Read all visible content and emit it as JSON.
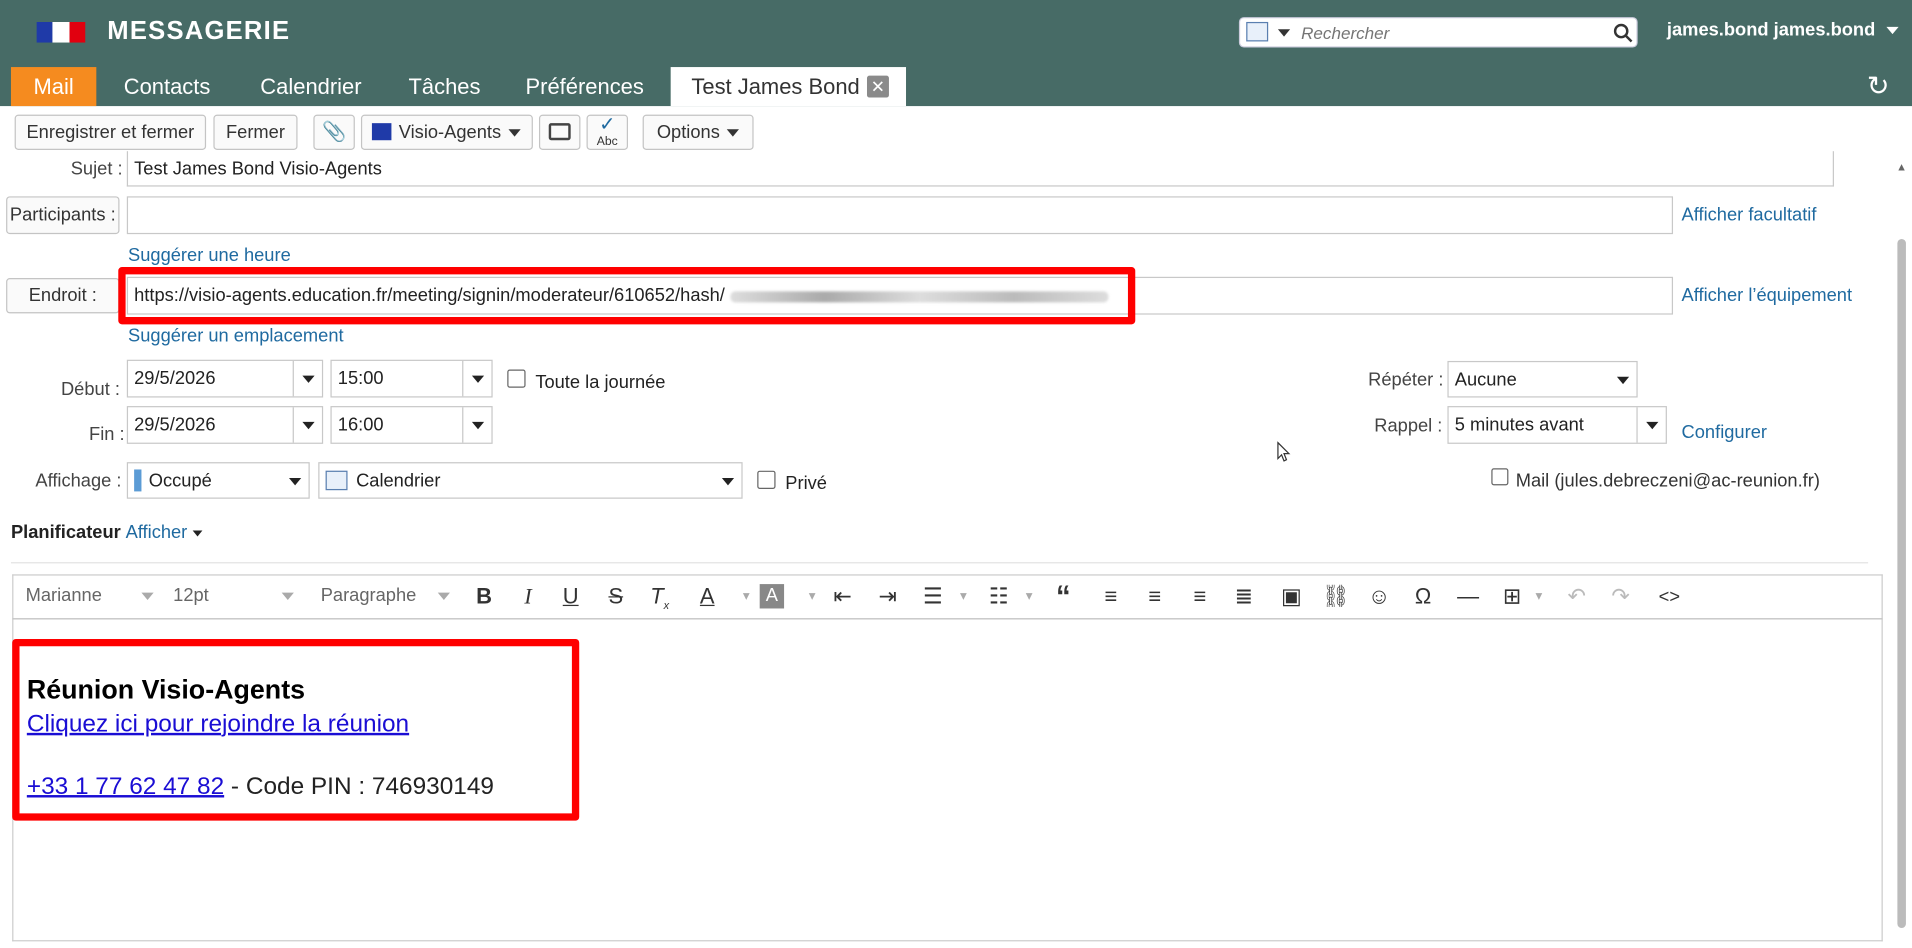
{
  "header": {
    "app_title": "MESSAGERIE",
    "search_placeholder": "Rechercher",
    "user_name": "james.bond james.bond"
  },
  "tabs": [
    "Mail",
    "Contacts",
    "Calendrier",
    "Tâches",
    "Préférences"
  ],
  "active_tab": {
    "label": "Test James Bond",
    "close": "✕"
  },
  "toolbar": {
    "save_close": "Enregistrer et fermer",
    "close": "Fermer",
    "visio": "Visio-Agents",
    "options": "Options"
  },
  "form": {
    "subject_label": "Sujet :",
    "subject_value": "Test James Bond Visio-Agents",
    "participants_label": "Participants :",
    "show_optional": "Afficher facultatif",
    "suggest_time": "Suggérer une heure",
    "location_label": "Endroit :",
    "location_value": "https://visio-agents.education.fr/meeting/signin/moderateur/610652/hash/",
    "show_equipment": "Afficher l’équipement",
    "suggest_location": "Suggérer un emplacement",
    "start_label": "Début :",
    "start_date": "29/5/2026",
    "start_time": "15:00",
    "all_day": "Toute la journée",
    "end_label": "Fin :",
    "end_date": "29/5/2026",
    "end_time": "16:00",
    "repeat_label": "Répéter :",
    "repeat_value": "Aucune",
    "reminder_label": "Rappel :",
    "reminder_value": "5 minutes avant",
    "configure": "Configurer",
    "display_label": "Affichage :",
    "display_value": "Occupé",
    "calendar_value": "Calendrier",
    "private": "Privé",
    "mail_checkbox": "Mail (jules.debreczeni@ac-reunion.fr)",
    "scheduler_label": "Planificateur",
    "scheduler_show": "Afficher"
  },
  "editor_toolbar": {
    "font": "Marianne",
    "size": "12pt",
    "block": "Paragraphe"
  },
  "editor_content": {
    "heading": "Réunion Visio-Agents",
    "join_link": "Cliquez ici pour rejoindre la réunion",
    "phone": "+33 1 77 62 47 82",
    "pin_text": " - Code PIN : 746930149"
  },
  "colors": {
    "header": "#476b66",
    "mail_tab": "#f58b1f",
    "highlight": "#ff0000",
    "link": "#1f6aa0"
  }
}
